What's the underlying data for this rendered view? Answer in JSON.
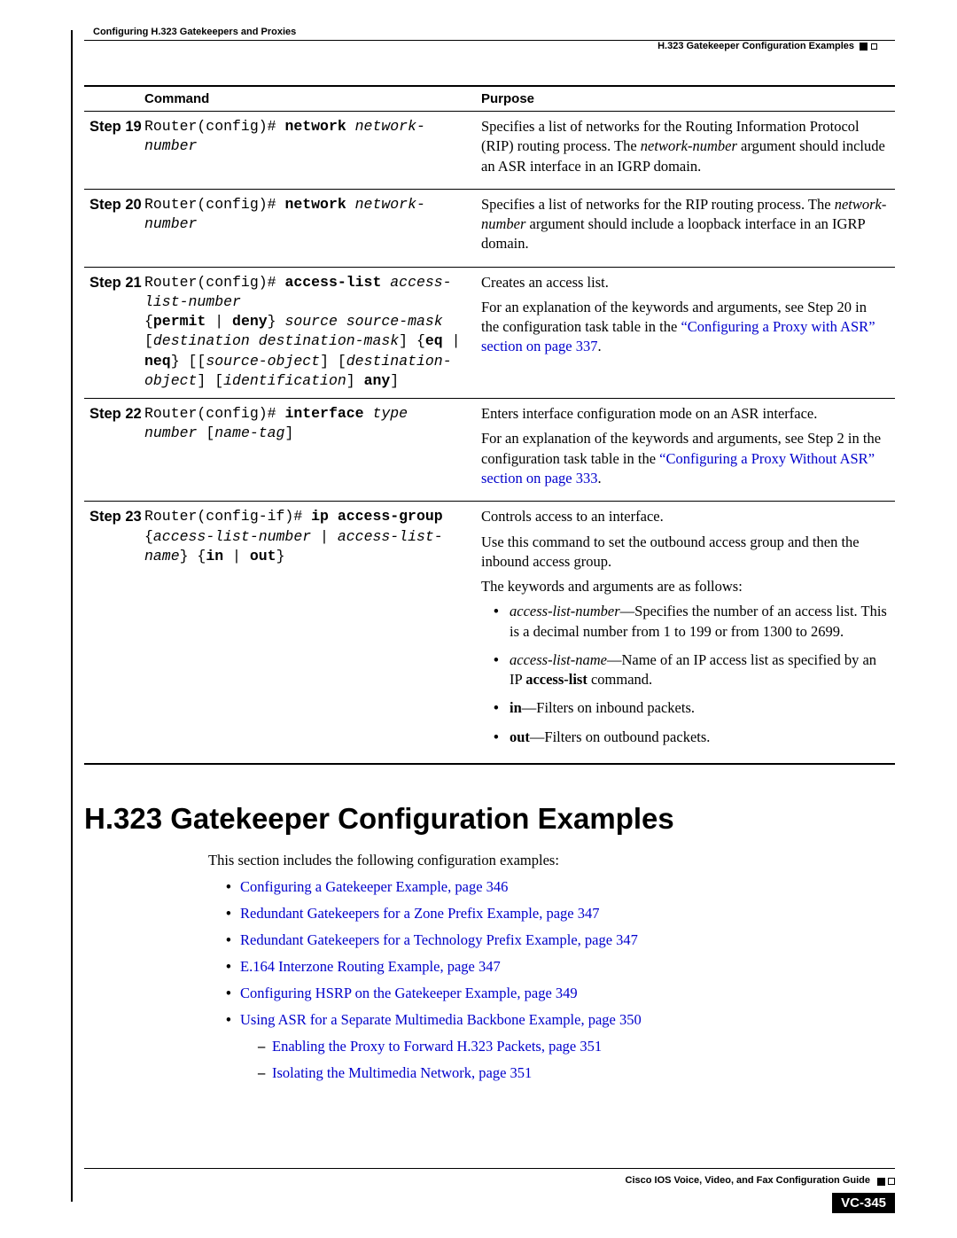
{
  "header": {
    "left": "Configuring H.323 Gatekeepers and Proxies",
    "right": "H.323 Gatekeeper Configuration Examples"
  },
  "table": {
    "headers": {
      "cmd": "Command",
      "purpose": "Purpose"
    },
    "rows": [
      {
        "step": "Step 19",
        "cmd_html": "Router(config)# <span class='b'>network</span> <span class='i'>network-number</span>",
        "purpose_html": "<p>Specifies a list of networks for the Routing Information Protocol (RIP) routing process. The <span class='ital'>network-number</span> argument should include an ASR interface in an IGRP domain.</p>"
      },
      {
        "step": "Step 20",
        "cmd_html": "Router(config)# <span class='b'>network</span> <span class='i'>network-number</span>",
        "purpose_html": "<p>Specifies a list of networks for the RIP routing process. The <span class='ital'>network-number</span> argument should include a loopback interface in an IGRP domain.</p>"
      },
      {
        "step": "Step 21",
        "cmd_html": "Router(config)# <span class='b'>access-list</span> <span class='i'>access-list-number</span><br>{<span class='b'>permit</span> | <span class='b'>deny</span>} <span class='i'>source source-mask</span> [<span class='i'>destination destination-mask</span>] {<span class='b'>eq</span> | <span class='b'>neq</span>} [[<span class='i'>source-object</span>] [<span class='i'>destination-object</span>] [<span class='i'>identification</span>] <span class='b'>any</span>]",
        "purpose_html": "<p>Creates an access list.</p><p>For an explanation of the keywords and arguments, see Step 20 in the configuration task table in the <span class='link'>“Configuring a Proxy with ASR” section on page 337</span>.</p>"
      },
      {
        "step": "Step 22",
        "cmd_html": "Router(config)# <span class='b'>interface</span> <span class='i'>type number</span> [<span class='i'>name-tag</span>]",
        "purpose_html": "<p>Enters interface configuration mode on an ASR interface.</p><p>For an explanation of the keywords and arguments, see Step 2 in the configuration task table in the <span class='link'>“Configuring a Proxy Without ASR” section on page 333</span>.</p>"
      },
      {
        "step": "Step 23",
        "cmd_html": "Router(config-if)# <span class='b'>ip access-group</span><br>{<span class='i'>access-list-number</span> | <span class='i'>access-list-name</span>} {<span class='b'>in</span> | <span class='b'>out</span>}",
        "purpose_html": "<p>Controls access to an interface.</p><p>Use this command to set the outbound access group and then the inbound access group.</p><p>The keywords and arguments are as follows:</p><ul><li><span class='ital'>access-list-number</span>—Specifies the number of an access list. This is a decimal number from 1 to 199 or from 1300 to 2699.</li><li><span class='ital'>access-list-name</span>—Name of an IP access list as specified by an IP <span class='bold'>access-list</span> command.</li><li><span class='bold'>in</span>—Filters on inbound packets.</li><li><span class='bold'>out</span>—Filters on outbound packets.</li></ul>"
      }
    ]
  },
  "section_heading": "H.323 Gatekeeper Configuration Examples",
  "intro": "This section includes the following configuration examples:",
  "examples": [
    "Configuring a Gatekeeper Example, page 346",
    "Redundant Gatekeepers for a Zone Prefix Example, page 347",
    "Redundant Gatekeepers for a Technology Prefix Example, page 347",
    "E.164 Interzone Routing Example, page 347",
    "Configuring HSRP on the Gatekeeper Example, page 349"
  ],
  "example_with_sub": {
    "label": "Using ASR for a Separate Multimedia Backbone Example, page 350",
    "subs": [
      "Enabling the Proxy to Forward H.323 Packets, page 351",
      "Isolating the Multimedia Network, page 351"
    ]
  },
  "footer": {
    "title": "Cisco IOS Voice, Video, and Fax Configuration Guide",
    "page": "VC-345"
  }
}
